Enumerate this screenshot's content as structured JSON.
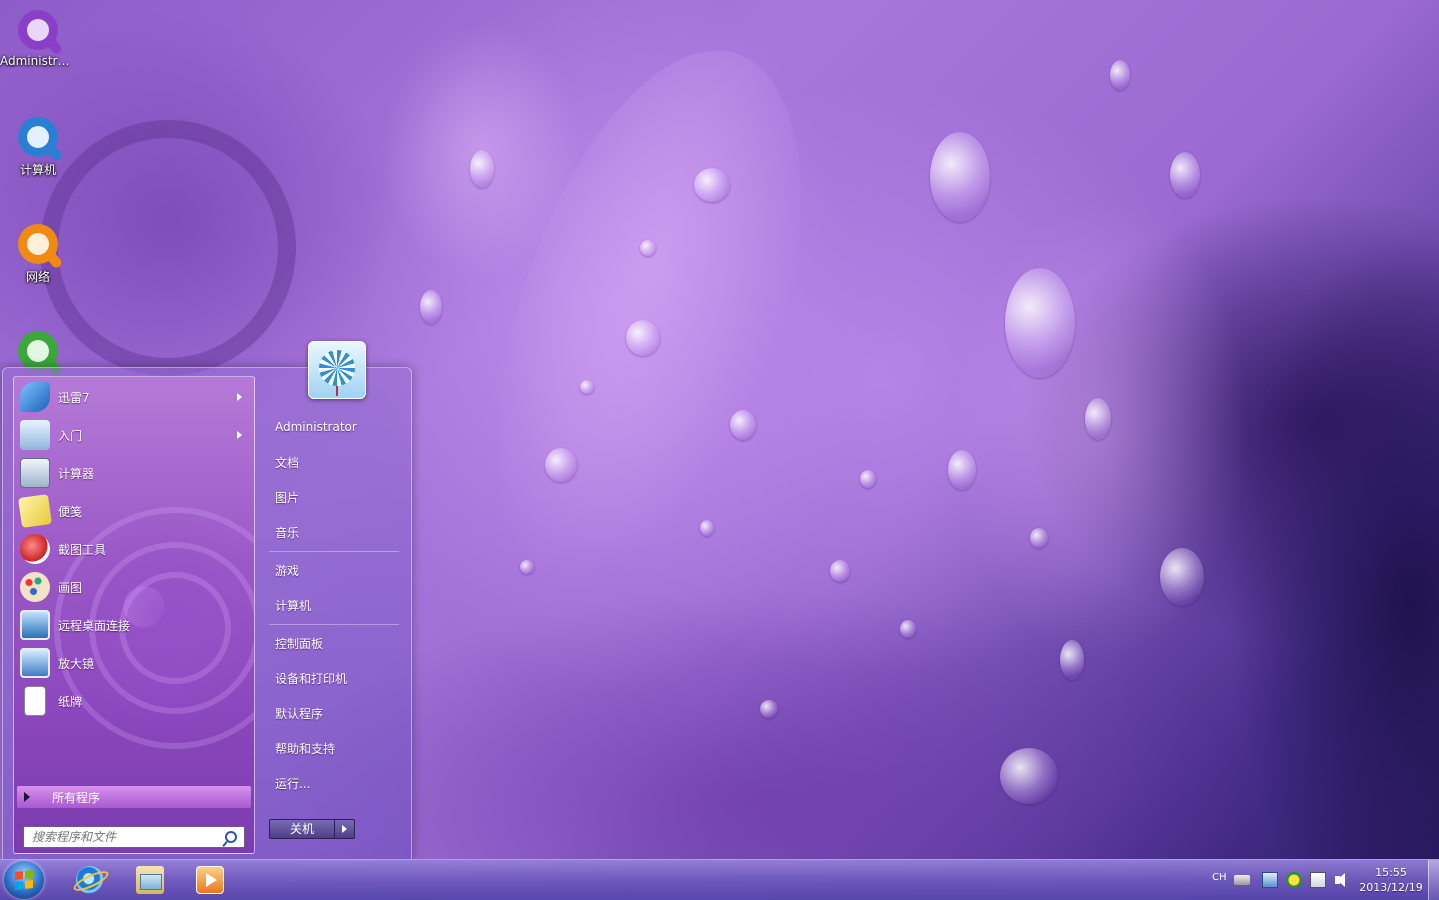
{
  "desktop": {
    "icons": [
      {
        "label": "Administra...",
        "color": "#8a3fc9"
      },
      {
        "label": "计算机",
        "color": "#2a7fd4"
      },
      {
        "label": "网络",
        "color": "#f08a12"
      },
      {
        "label": "",
        "color": "#3aa83a"
      }
    ]
  },
  "start_menu": {
    "programs": [
      {
        "label": "迅雷7",
        "icon": "xunlei-bird-icon",
        "has_submenu": true
      },
      {
        "label": "入门",
        "icon": "getting-started-icon",
        "has_submenu": true
      },
      {
        "label": "计算器",
        "icon": "calculator-icon",
        "has_submenu": false
      },
      {
        "label": "便笺",
        "icon": "sticky-notes-icon",
        "has_submenu": false
      },
      {
        "label": "截图工具",
        "icon": "snipping-tool-icon",
        "has_submenu": false
      },
      {
        "label": "画图",
        "icon": "paint-icon",
        "has_submenu": false
      },
      {
        "label": "远程桌面连接",
        "icon": "remote-desktop-icon",
        "has_submenu": false
      },
      {
        "label": "放大镜",
        "icon": "magnifier-icon",
        "has_submenu": false
      },
      {
        "label": "纸牌",
        "icon": "solitaire-icon",
        "has_submenu": false
      }
    ],
    "all_programs_label": "所有程序",
    "search_placeholder": "搜索程序和文件",
    "user_name": "Administrator",
    "places": [
      {
        "label": "文档"
      },
      {
        "label": "图片"
      },
      {
        "label": "音乐"
      },
      {
        "label": "游戏"
      },
      {
        "label": "计算机"
      },
      {
        "label": "控制面板"
      },
      {
        "label": "设备和打印机"
      },
      {
        "label": "默认程序"
      },
      {
        "label": "帮助和支持"
      },
      {
        "label": "运行..."
      }
    ],
    "shutdown_label": "关机"
  },
  "taskbar": {
    "apps": [
      {
        "name": "internet-explorer",
        "icon": "ie-icon"
      },
      {
        "name": "windows-explorer",
        "icon": "folder-icon"
      },
      {
        "name": "media-player",
        "icon": "media-player-icon"
      }
    ],
    "tray": {
      "language": "CH",
      "time": "15:55",
      "date": "2013/12/19"
    }
  }
}
